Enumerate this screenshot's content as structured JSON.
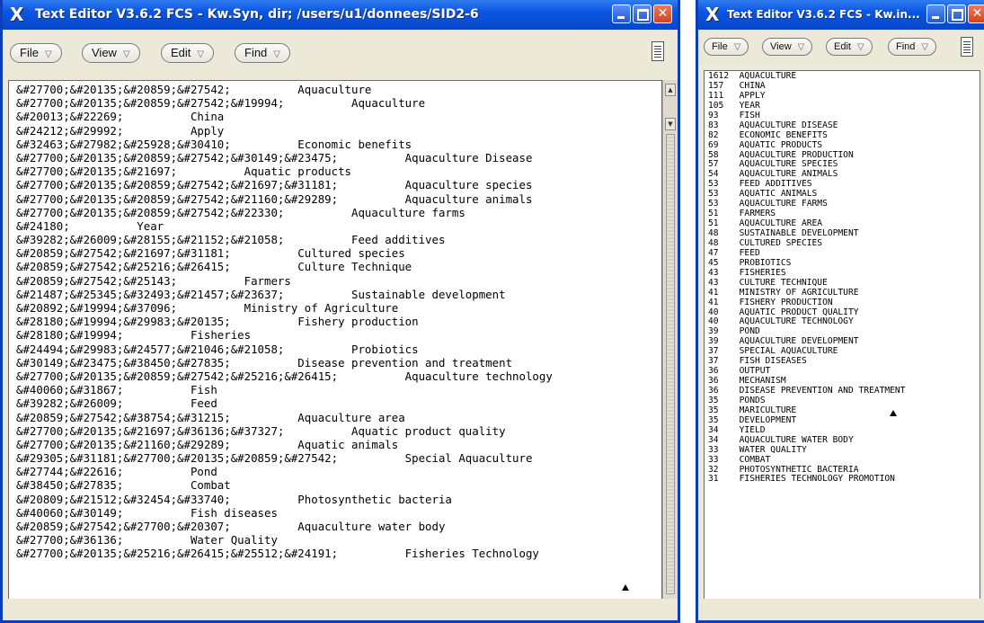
{
  "left_window": {
    "title": "Text Editor V3.6.2 FCS - Kw.Syn, dir; /users/u1/donnees/SID2-6",
    "menu": [
      {
        "label": "File",
        "arrow": "▽"
      },
      {
        "label": "View",
        "arrow": "▽"
      },
      {
        "label": "Edit",
        "arrow": "▽"
      },
      {
        "label": "Find",
        "arrow": "▽"
      }
    ],
    "lines": [
      "&#27700;&#20135;&#20859;&#27542;          Aquaculture",
      "&#27700;&#20135;&#20859;&#27542;&#19994;          Aquaculture",
      "&#20013;&#22269;          China",
      "&#24212;&#29992;          Apply",
      "&#32463;&#27982;&#25928;&#30410;          Economic benefits",
      "&#27700;&#20135;&#20859;&#27542;&#30149;&#23475;          Aquaculture Disease",
      "&#27700;&#20135;&#21697;          Aquatic products",
      "&#27700;&#20135;&#20859;&#27542;&#21697;&#31181;          Aquaculture species",
      "&#27700;&#20135;&#20859;&#27542;&#21160;&#29289;          Aquaculture animals",
      "&#27700;&#20135;&#20859;&#27542;&#22330;          Aquaculture farms",
      "&#24180;          Year",
      "&#39282;&#26009;&#28155;&#21152;&#21058;          Feed additives",
      "&#20859;&#27542;&#21697;&#31181;          Cultured species",
      "&#20859;&#27542;&#25216;&#26415;          Culture Technique",
      "&#20859;&#27542;&#25143;          Farmers",
      "&#21487;&#25345;&#32493;&#21457;&#23637;          Sustainable development",
      "&#20892;&#19994;&#37096;          Ministry of Agriculture",
      "&#28180;&#19994;&#29983;&#20135;          Fishery production",
      "&#28180;&#19994;          Fisheries",
      "&#24494;&#29983;&#24577;&#21046;&#21058;          Probiotics",
      "&#30149;&#23475;&#38450;&#27835;          Disease prevention and treatment",
      "&#27700;&#20135;&#20859;&#27542;&#25216;&#26415;          Aquaculture technology",
      "&#40060;&#31867;          Fish",
      "&#39282;&#26009;          Feed",
      "&#20859;&#27542;&#38754;&#31215;          Aquaculture area",
      "&#27700;&#20135;&#21697;&#36136;&#37327;          Aquatic product quality",
      "&#27700;&#20135;&#21160;&#29289;          Aquatic animals",
      "&#29305;&#31181;&#27700;&#20135;&#20859;&#27542;          Special Aquaculture",
      "&#27744;&#22616;          Pond",
      "&#38450;&#27835;          Combat",
      "&#20809;&#21512;&#32454;&#33740;          Photosynthetic bacteria",
      "&#40060;&#30149;          Fish diseases",
      "&#20859;&#27542;&#27700;&#20307;          Aquaculture water body",
      "&#27700;&#36136;          Water Quality",
      "&#27700;&#20135;&#25216;&#26415;&#25512;&#24191;          Fisheries Technology"
    ]
  },
  "right_window": {
    "title": "Text Editor V3.6.2 FCS - Kw.in...",
    "menu": [
      {
        "label": "File",
        "arrow": "▽"
      },
      {
        "label": "View",
        "arrow": "▽"
      },
      {
        "label": "Edit",
        "arrow": "▽"
      },
      {
        "label": "Find",
        "arrow": "▽"
      }
    ],
    "lines": [
      "1612  AQUACULTURE",
      "157   CHINA",
      "111   APPLY",
      "105   YEAR",
      "93    FISH",
      "83    AQUACULTURE DISEASE",
      "82    ECONOMIC BENEFITS",
      "69    AQUATIC PRODUCTS",
      "58    AQUACULTURE PRODUCTION",
      "57    AQUACULTURE SPECIES",
      "54    AQUACULTURE ANIMALS",
      "53    FEED ADDITIVES",
      "53    AQUATIC ANIMALS",
      "53    AQUACULTURE FARMS",
      "51    FARMERS",
      "51    AQUACULTURE AREA",
      "48    SUSTAINABLE DEVELOPMENT",
      "48    CULTURED SPECIES",
      "47    FEED",
      "45    PROBIOTICS",
      "43    FISHERIES",
      "43    CULTURE TECHNIQUE",
      "41    MINISTRY OF AGRICULTURE",
      "41    FISHERY PRODUCTION",
      "40    AQUATIC PRODUCT QUALITY",
      "40    AQUACULTURE TECHNOLOGY",
      "39    POND",
      "39    AQUACULTURE DEVELOPMENT",
      "37    SPECIAL AQUACULTURE",
      "37    FISH DISEASES",
      "36    OUTPUT",
      "36    MECHANISM",
      "36    DISEASE PREVENTION AND TREATMENT",
      "35    PONDS",
      "35    MARICULTURE",
      "35    DEVELOPMENT",
      "34    YIELD",
      "34    AQUACULTURE WATER BODY",
      "33    WATER QUALITY",
      "33    COMBAT",
      "32    PHOTOSYNTHETIC BACTERIA",
      "31    FISHERIES TECHNOLOGY PROMOTION"
    ]
  },
  "icons": {
    "app": "x-window-icon",
    "minimize": "minimize-icon",
    "maximize": "maximize-icon",
    "close": "close-icon",
    "notes": "notes-icon"
  }
}
